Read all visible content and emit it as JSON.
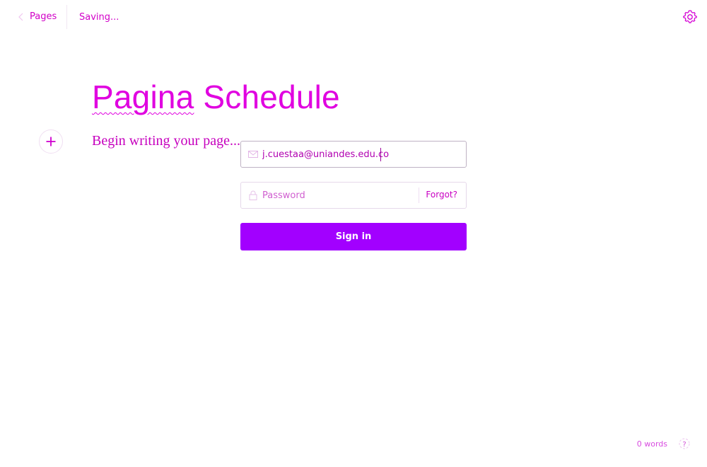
{
  "topbar": {
    "back_label": "Pages",
    "status": "Saving..."
  },
  "page": {
    "title_first": "Pagina",
    "title_rest": " Schedule",
    "body_placeholder": "Begin writing your page..."
  },
  "login": {
    "email_value": "j.cuestaa@uniandes.edu.co",
    "password_placeholder": "Password",
    "forgot_label": "Forgot?",
    "signin_label": "Sign in"
  },
  "footer": {
    "word_count": "0 words",
    "help_icon": "help-icon"
  },
  "colors": {
    "accent": "#e000e0",
    "button": "#a200ff",
    "text_muted": "#d200c9"
  }
}
